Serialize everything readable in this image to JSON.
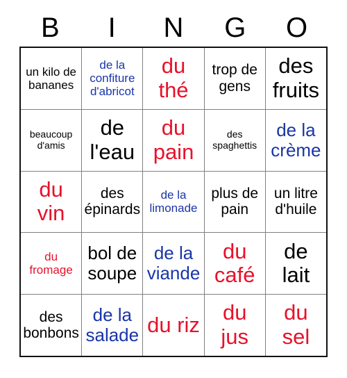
{
  "title": "BINGO",
  "header": {
    "letters": [
      "B",
      "I",
      "N",
      "G",
      "O"
    ]
  },
  "colors": {
    "black": "#000000",
    "red": "#e8112a",
    "blue": "#1a35a8",
    "grid_border": "#111111",
    "grid_line": "#808080",
    "background": "#ffffff"
  },
  "grid": {
    "columns": 5,
    "rows": 5,
    "cells": [
      [
        {
          "text": "un kilo de bananes",
          "color": "black",
          "size": "sm"
        },
        {
          "text": "de la confiture d'abricot",
          "color": "blue",
          "size": "sm"
        },
        {
          "text": "du thé",
          "color": "red",
          "size": "xl"
        },
        {
          "text": "trop de gens",
          "color": "black",
          "size": "md"
        },
        {
          "text": "des fruits",
          "color": "black",
          "size": "xl"
        }
      ],
      [
        {
          "text": "beaucoup d'amis",
          "color": "black",
          "size": "xs"
        },
        {
          "text": "de l'eau",
          "color": "black",
          "size": "xl"
        },
        {
          "text": "du pain",
          "color": "red",
          "size": "xl"
        },
        {
          "text": "des spaghettis",
          "color": "black",
          "size": "xs"
        },
        {
          "text": "de la crème",
          "color": "blue",
          "size": "lg"
        }
      ],
      [
        {
          "text": "du vin",
          "color": "red",
          "size": "xl"
        },
        {
          "text": "des épinards",
          "color": "black",
          "size": "md"
        },
        {
          "text": "de la limonade",
          "color": "blue",
          "size": "sm"
        },
        {
          "text": "plus de pain",
          "color": "black",
          "size": "md"
        },
        {
          "text": "un litre d'huile",
          "color": "black",
          "size": "md"
        }
      ],
      [
        {
          "text": "du fromage",
          "color": "red",
          "size": "sm"
        },
        {
          "text": "bol de soupe",
          "color": "black",
          "size": "lg"
        },
        {
          "text": "de la viande",
          "color": "blue",
          "size": "lg"
        },
        {
          "text": "du café",
          "color": "red",
          "size": "xl"
        },
        {
          "text": "de lait",
          "color": "black",
          "size": "xl"
        }
      ],
      [
        {
          "text": "des bonbons",
          "color": "black",
          "size": "md"
        },
        {
          "text": "de la salade",
          "color": "blue",
          "size": "lg"
        },
        {
          "text": "du riz",
          "color": "red",
          "size": "xl"
        },
        {
          "text": "du jus",
          "color": "red",
          "size": "xl"
        },
        {
          "text": "du sel",
          "color": "red",
          "size": "xl"
        }
      ]
    ]
  }
}
